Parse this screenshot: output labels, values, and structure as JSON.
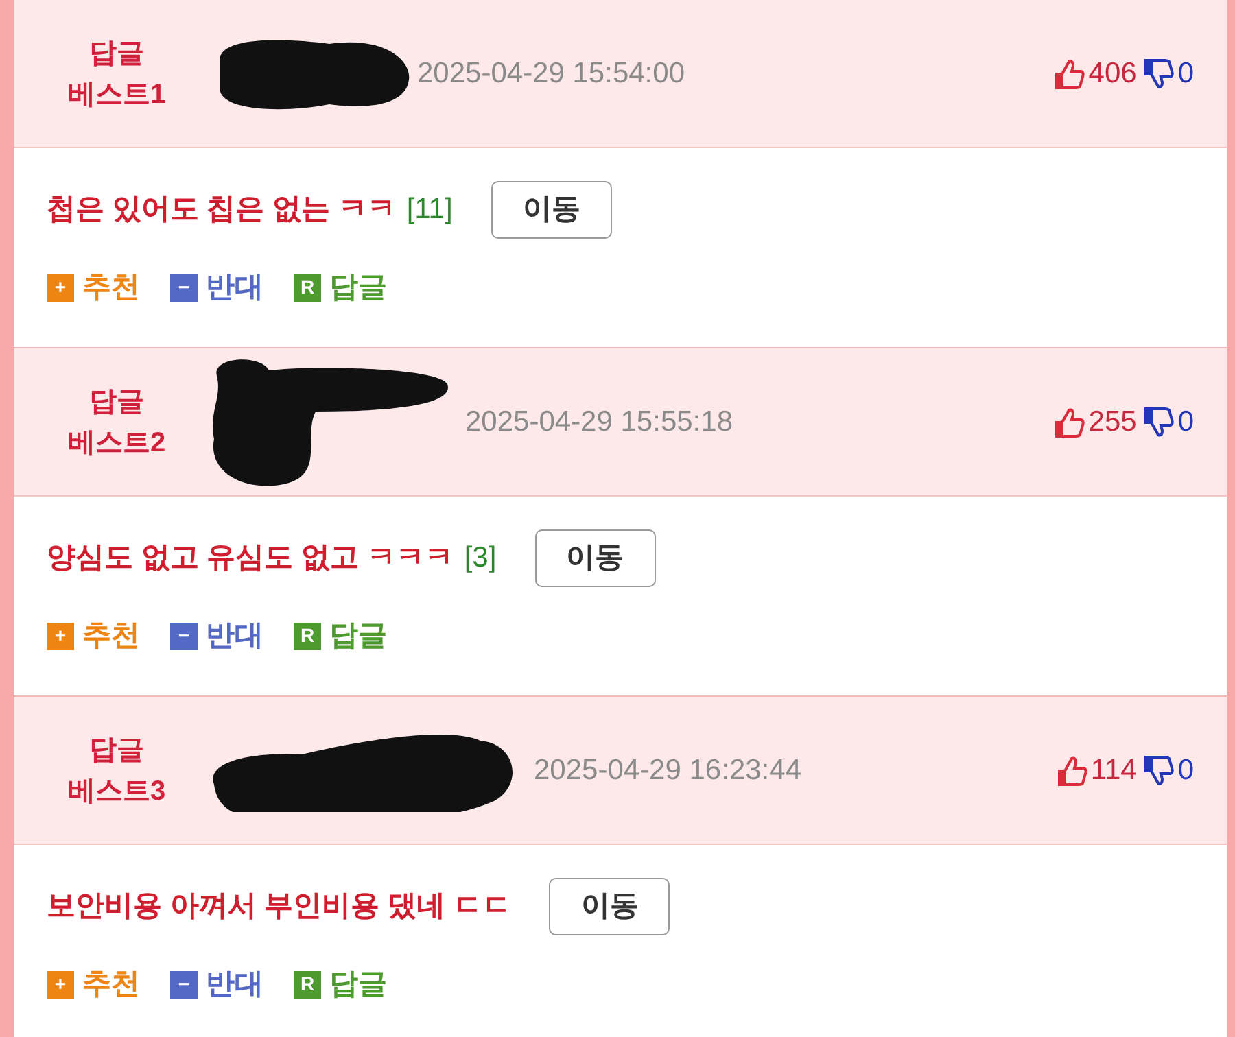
{
  "comments": [
    {
      "rank_label": "답글",
      "rank": "베스트1",
      "time": "2025-04-29 15:54:00",
      "likes": "406",
      "dislikes": "0",
      "text": "첩은 있어도 칩은 없는 ㅋㅋ",
      "reply_count": "[11]",
      "move_button": "이동",
      "actions": [
        {
          "kind": "recommend",
          "icon": "+",
          "label": "추천"
        },
        {
          "kind": "oppose",
          "icon": "−",
          "label": "반대"
        },
        {
          "kind": "reply",
          "icon": "R",
          "label": "답글"
        }
      ]
    },
    {
      "rank_label": "답글",
      "rank": "베스트2",
      "time": "2025-04-29 15:55:18",
      "likes": "255",
      "dislikes": "0",
      "text": "양심도 없고 유심도 없고 ㅋㅋㅋ",
      "reply_count": "[3]",
      "move_button": "이동",
      "actions": [
        {
          "kind": "recommend",
          "icon": "+",
          "label": "추천"
        },
        {
          "kind": "oppose",
          "icon": "−",
          "label": "반대"
        },
        {
          "kind": "reply",
          "icon": "R",
          "label": "답글"
        }
      ]
    },
    {
      "rank_label": "답글",
      "rank": "베스트3",
      "time": "2025-04-29 16:23:44",
      "likes": "114",
      "dislikes": "0",
      "text": "보안비용 아껴서 부인비용 댔네 ㄷㄷ",
      "move_button": "이동",
      "actions": [
        {
          "kind": "recommend",
          "icon": "+",
          "label": "추천"
        },
        {
          "kind": "oppose",
          "icon": "−",
          "label": "반대"
        },
        {
          "kind": "reply",
          "icon": "R",
          "label": "답글"
        }
      ]
    }
  ]
}
